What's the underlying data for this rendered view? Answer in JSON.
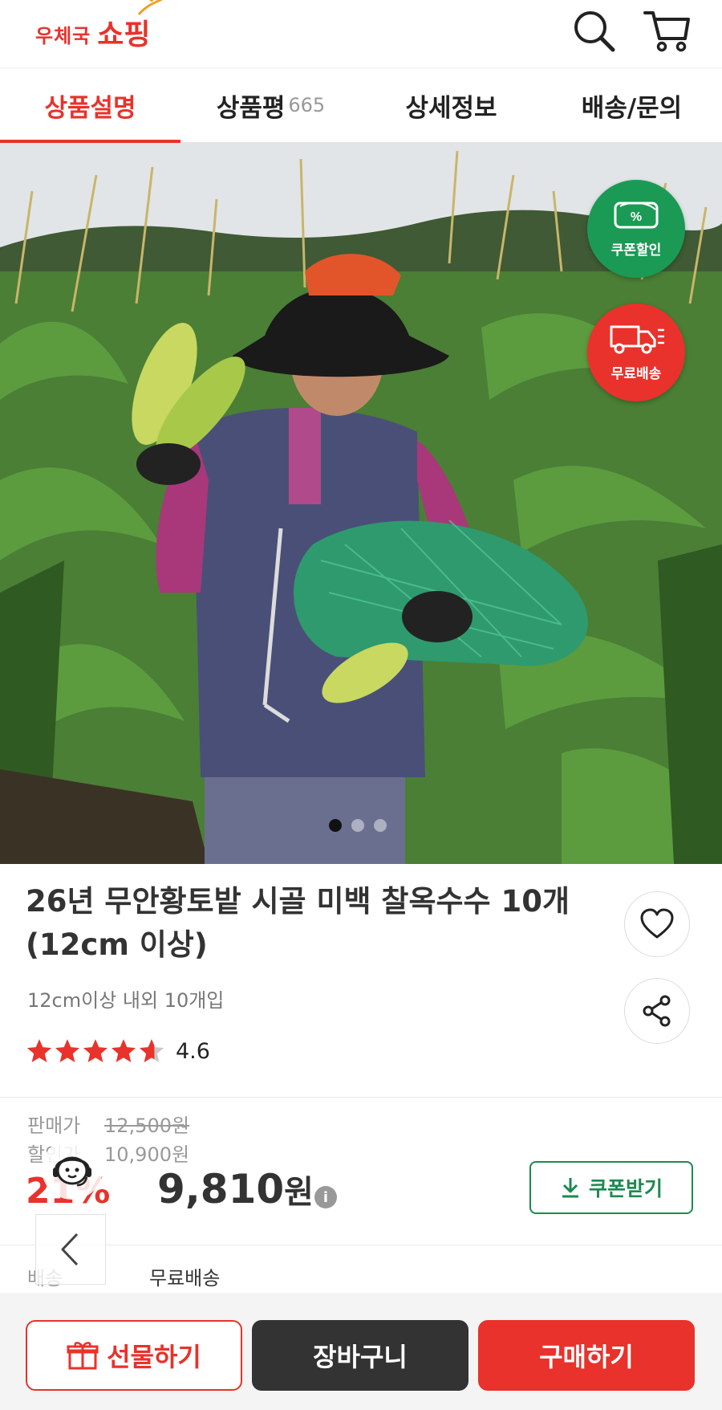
{
  "header": {
    "logo_small": "우체국",
    "logo_big": "쇼핑",
    "search_icon": "search-icon",
    "cart_icon": "cart-icon"
  },
  "tabs": [
    {
      "label": "상품설명",
      "count": "",
      "active": true
    },
    {
      "label": "상품평",
      "count": "665",
      "active": false
    },
    {
      "label": "상세정보",
      "count": "",
      "active": false
    },
    {
      "label": "배송/문의",
      "count": "",
      "active": false
    }
  ],
  "hero": {
    "badges": [
      {
        "label": "쿠폰할인",
        "icon": "coupon-percent-icon",
        "color": "#1b9a55"
      },
      {
        "label": "무료배송",
        "icon": "delivery-truck-icon",
        "color": "#e8322b"
      }
    ],
    "slide_index": 1,
    "slide_count": 3
  },
  "product": {
    "title_line1": "26년 무안황토밭 시골 미백 찰옥수수 10개",
    "title_line2": "(12cm 이상)",
    "subtitle": "12cm이상 내외 10개입",
    "rating": 4.6,
    "rating_text": "4.6"
  },
  "price": {
    "sale_label": "판매가",
    "sale_price": "12,500원",
    "discount_label": "할인가",
    "discount_price": "10,900원",
    "rate": "21%",
    "final_amount": "9,810",
    "final_unit": "원",
    "coupon_button": "쿠폰받기"
  },
  "shipping": {
    "label": "배송",
    "value": "무료배송"
  },
  "bottom": {
    "gift": "선물하기",
    "cart": "장바구니",
    "buy": "구매하기"
  },
  "colors": {
    "brand_red": "#e8322b",
    "coupon_green": "#1b8a4f",
    "dark": "#333333"
  }
}
